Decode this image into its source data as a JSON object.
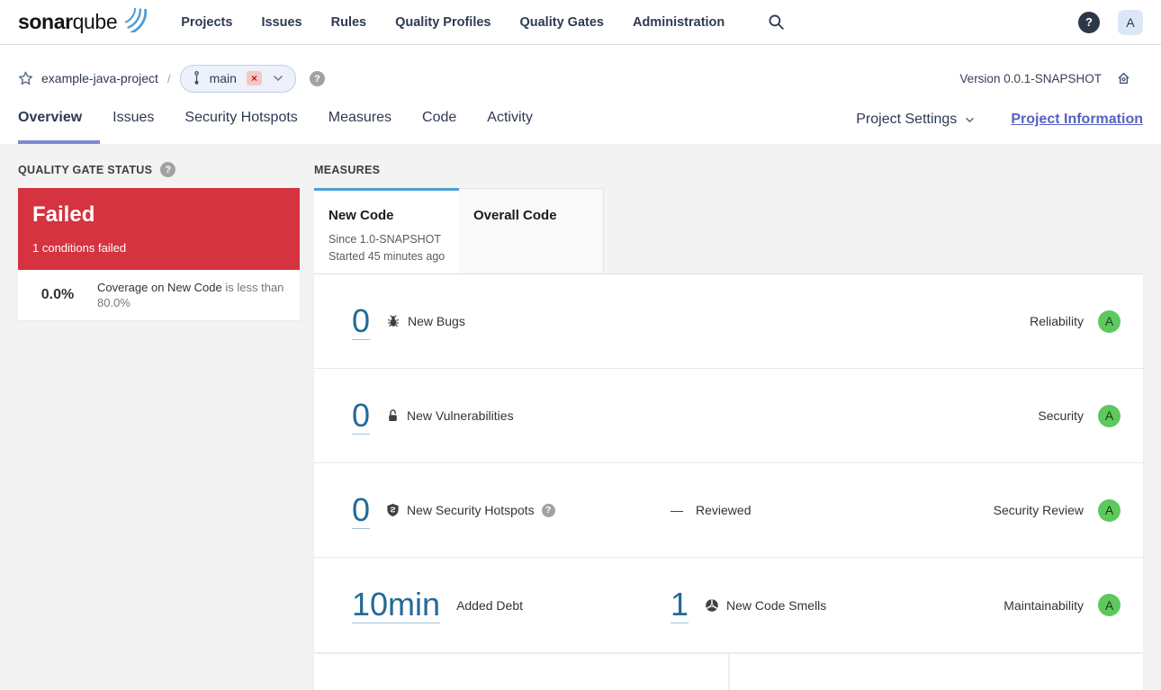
{
  "header": {
    "brand": {
      "bold": "sonar",
      "light": "qube"
    },
    "nav": [
      "Projects",
      "Issues",
      "Rules",
      "Quality Profiles",
      "Quality Gates",
      "Administration"
    ],
    "help": "?",
    "avatar": "A"
  },
  "breadcrumb": {
    "project": "example-java-project",
    "separator": "/",
    "branch": "main",
    "branch_badge": "×",
    "branch_help": "?",
    "version": "Version 0.0.1-SNAPSHOT"
  },
  "tabs": {
    "overview": "Overview",
    "issues": "Issues",
    "security_hotspots": "Security Hotspots",
    "measures": "Measures",
    "code": "Code",
    "activity": "Activity",
    "project_settings": "Project Settings",
    "project_information": "Project Information"
  },
  "quality_gate": {
    "title": "QUALITY GATE STATUS",
    "help": "?",
    "status": "Failed",
    "failed_conditions": "1 conditions failed",
    "condition_value": "0.0%",
    "condition_metric": "Coverage on New Code",
    "condition_rule": "is less than 80.0%"
  },
  "measures": {
    "title": "MEASURES",
    "new_code_tab": {
      "label": "New Code",
      "since": "Since 1.0-SNAPSHOT",
      "started": "Started 45 minutes ago"
    },
    "overall_code_tab": {
      "label": "Overall Code"
    },
    "rows": [
      {
        "value": "0",
        "label": "New Bugs",
        "rating_label": "Reliability",
        "rating": "A"
      },
      {
        "value": "0",
        "label": "New Vulnerabilities",
        "rating_label": "Security",
        "rating": "A"
      },
      {
        "value": "0",
        "label": "New Security Hotspots",
        "help": "?",
        "reviewed_dash": "—",
        "reviewed_label": "Reviewed",
        "rating_label": "Security Review",
        "rating": "A"
      },
      {
        "value": "10min",
        "label": "Added Debt",
        "second_value": "1",
        "second_label": "New Code Smells",
        "rating_label": "Maintainability",
        "rating": "A"
      }
    ]
  },
  "colors": {
    "failed_red": "#d4333f",
    "link_blue": "#236a97",
    "rating_a_green": "#5dc95d",
    "accent_purple": "#5663c1",
    "tab_active_blue": "#4b9fd5",
    "brand_swoosh_blue": "#4e9cd3"
  }
}
